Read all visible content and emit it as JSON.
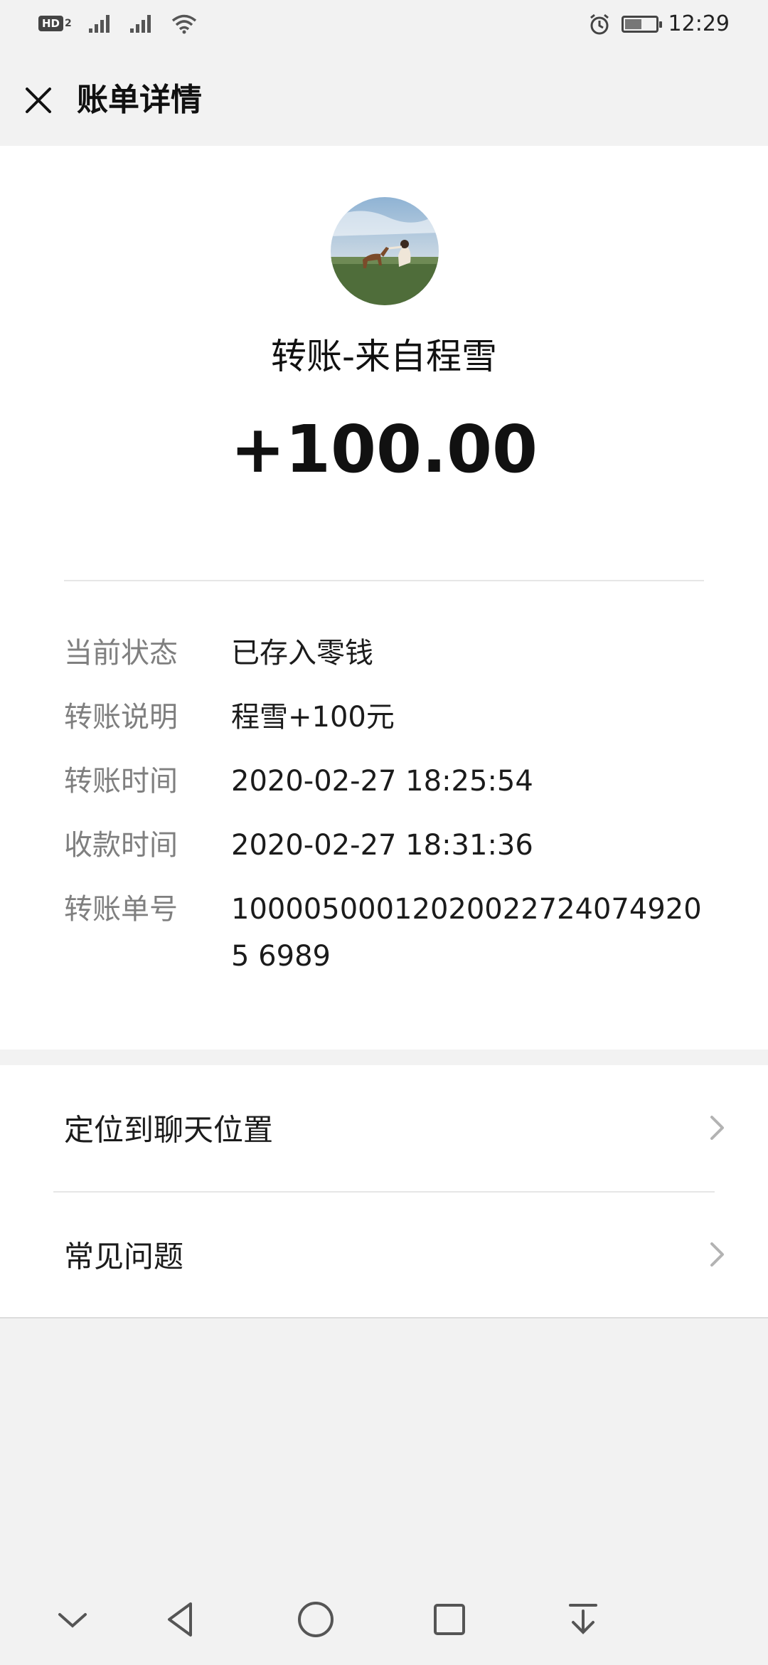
{
  "status_bar": {
    "hd_label": "HD",
    "hd_sub": "2",
    "time": "12:29",
    "battery_level": 0.6
  },
  "header": {
    "title": "账单详情",
    "close_icon": "close-icon"
  },
  "summary": {
    "title": "转账-来自程雪",
    "amount": "+100.00"
  },
  "details": [
    {
      "label": "当前状态",
      "value": "已存入零钱"
    },
    {
      "label": "转账说明",
      "value": "程雪+100元"
    },
    {
      "label": "转账时间",
      "value": "2020-02-27 18:25:54"
    },
    {
      "label": "收款时间",
      "value": "2020-02-27 18:31:36"
    },
    {
      "label": "转账单号",
      "value": "100005000120200227240749205 6989"
    }
  ],
  "actions": [
    {
      "label": "定位到聊天位置",
      "icon": "chevron-right-icon"
    },
    {
      "label": "常见问题",
      "icon": "chevron-right-icon"
    }
  ],
  "nav": {
    "icons": [
      "chevron-down-icon",
      "back-triangle-icon",
      "home-circle-icon",
      "recents-square-icon",
      "pull-down-icon"
    ]
  }
}
